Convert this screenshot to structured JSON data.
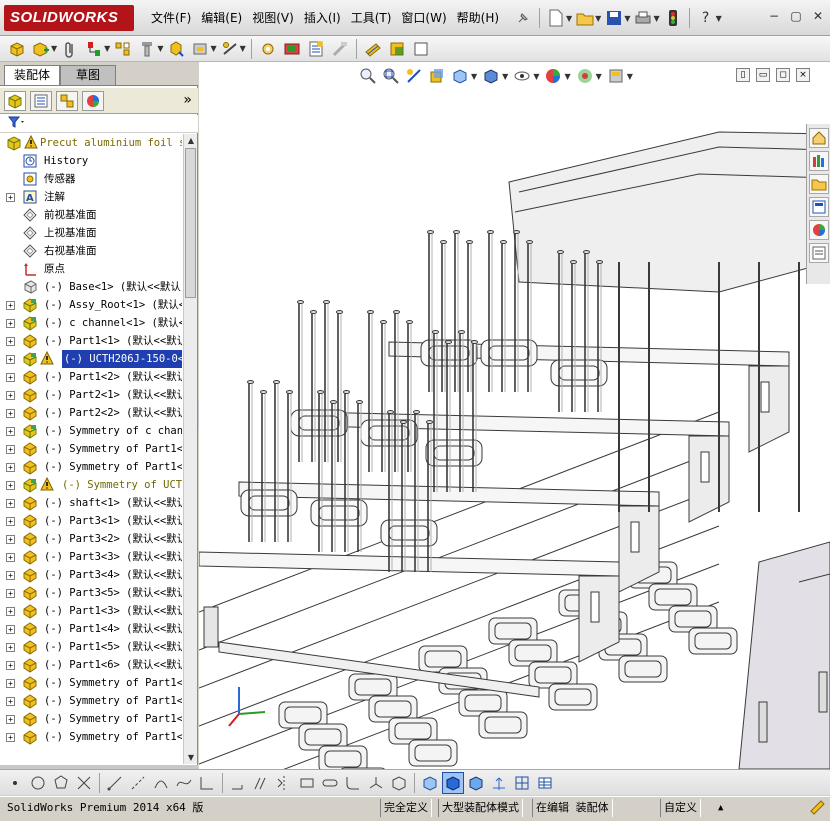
{
  "app": {
    "logo_text": "SOLIDWORKS"
  },
  "menu": [
    "文件(F)",
    "编辑(E)",
    "视图(V)",
    "插入(I)",
    "工具(T)",
    "窗口(W)",
    "帮助(H)"
  ],
  "title_tools": [
    "pin-icon",
    "new-document-icon",
    "open-folder-icon",
    "save-icon",
    "print-icon",
    "traffic-light-icon",
    "help-icon"
  ],
  "window_controls": {
    "minimize": "−",
    "restore": "▢",
    "close": "✕"
  },
  "command_toolbar": [
    "edit-component-icon",
    "insert-component-icon",
    "paperclip-icon",
    "mate-icon",
    "linear-pattern-icon",
    "smart-fasteners-icon",
    "move-component-icon",
    "show-hidden-icon",
    "assembly-features-icon",
    "reference-geometry-icon",
    "new-motion-study-icon",
    "bill-of-materials-icon",
    "exploded-view-icon",
    "explode-line-sketch-icon",
    "interference-detection-icon",
    "clearance-verification-icon",
    "hole-alignment-icon",
    "instant3d-icon"
  ],
  "left_tabs": {
    "assembly": "装配体",
    "sketch": "草图"
  },
  "feature_manager_tabs": [
    "feature-manager-icon",
    "property-manager-icon",
    "configuration-manager-icon",
    "display-manager-icon"
  ],
  "tree": {
    "root": "Precut aluminium foil se",
    "items": [
      {
        "label": "History",
        "icon": "history-icon",
        "expand": false,
        "kind": "folder"
      },
      {
        "label": "传感器",
        "icon": "sensor-icon",
        "expand": false,
        "kind": "folder"
      },
      {
        "label": "注解",
        "icon": "annotation-icon",
        "expand": true,
        "kind": "folder"
      },
      {
        "label": "前视基准面",
        "icon": "plane-icon",
        "expand": false,
        "kind": "plane"
      },
      {
        "label": "上视基准面",
        "icon": "plane-icon",
        "expand": false,
        "kind": "plane"
      },
      {
        "label": "右视基准面",
        "icon": "plane-icon",
        "expand": false,
        "kind": "plane"
      },
      {
        "label": "原点",
        "icon": "origin-icon",
        "expand": false,
        "kind": "origin"
      },
      {
        "label": "(-) Base<1> (默认<<默认",
        "icon": "part-icon",
        "expand": false,
        "kind": "part"
      },
      {
        "label": "(-) Assy_Root<1> (默认<",
        "icon": "subassembly-icon",
        "expand": true,
        "kind": "asm"
      },
      {
        "label": "(-) c channel<1> (默认<",
        "icon": "subassembly-icon",
        "expand": true,
        "kind": "asm"
      },
      {
        "label": "(-) Part1<1> (默认<<默认",
        "icon": "part-icon",
        "expand": true,
        "kind": "part"
      },
      {
        "label": "(-) UCTH206J-150-0<1",
        "icon": "subassembly-icon",
        "expand": true,
        "kind": "asm-warn-sel"
      },
      {
        "label": "(-) Part1<2> (默认<<默认",
        "icon": "part-icon",
        "expand": true,
        "kind": "part"
      },
      {
        "label": "(-) Part2<1> (默认<<默认",
        "icon": "part-icon",
        "expand": true,
        "kind": "part"
      },
      {
        "label": "(-) Part2<2> (默认<<默认",
        "icon": "part-icon",
        "expand": true,
        "kind": "part"
      },
      {
        "label": "(-) Symmetry of c chann",
        "icon": "subassembly-icon",
        "expand": true,
        "kind": "asm"
      },
      {
        "label": "(-) Symmetry of Part1<1",
        "icon": "part-icon",
        "expand": true,
        "kind": "part"
      },
      {
        "label": "(-) Symmetry of Part1<2",
        "icon": "part-icon",
        "expand": true,
        "kind": "part"
      },
      {
        "label": "(-) Symmetry of UCTH",
        "icon": "subassembly-icon",
        "expand": true,
        "kind": "asm-warn"
      },
      {
        "label": "(-) shaft<1> (默认<<默认",
        "icon": "part-icon",
        "expand": true,
        "kind": "part"
      },
      {
        "label": "(-) Part3<1> (默认<<默认",
        "icon": "part-icon",
        "expand": true,
        "kind": "part"
      },
      {
        "label": "(-) Part3<2> (默认<<默认",
        "icon": "part-icon",
        "expand": true,
        "kind": "part"
      },
      {
        "label": "(-) Part3<3> (默认<<默认",
        "icon": "part-icon",
        "expand": true,
        "kind": "part"
      },
      {
        "label": "(-) Part3<4> (默认<<默认",
        "icon": "part-icon",
        "expand": true,
        "kind": "part"
      },
      {
        "label": "(-) Part3<5> (默认<<默认",
        "icon": "part-icon",
        "expand": true,
        "kind": "part"
      },
      {
        "label": "(-) Part1<3> (默认<<默认",
        "icon": "part-icon",
        "expand": true,
        "kind": "part"
      },
      {
        "label": "(-) Part1<4> (默认<<默认",
        "icon": "part-icon",
        "expand": true,
        "kind": "part"
      },
      {
        "label": "(-) Part1<5> (默认<<默认",
        "icon": "part-icon",
        "expand": true,
        "kind": "part"
      },
      {
        "label": "(-) Part1<6> (默认<<默认",
        "icon": "part-icon",
        "expand": true,
        "kind": "part"
      },
      {
        "label": "(-) Symmetry of Part1<3",
        "icon": "part-icon",
        "expand": true,
        "kind": "part"
      },
      {
        "label": "(-) Symmetry of Part1<4",
        "icon": "part-icon",
        "expand": true,
        "kind": "part"
      },
      {
        "label": "(-) Symmetry of Part1<5",
        "icon": "part-icon",
        "expand": true,
        "kind": "part"
      },
      {
        "label": "(-) Symmetry of Part1<6",
        "icon": "part-icon",
        "expand": true,
        "kind": "part"
      }
    ]
  },
  "headsup_toolbar": [
    "zoom-to-fit-icon",
    "zoom-to-area-icon",
    "previous-view-icon",
    "section-view-icon",
    "view-orientation-icon",
    "display-style-icon",
    "hide-show-items-icon",
    "edit-appearance-icon",
    "apply-scene-icon",
    "view-settings-icon"
  ],
  "viewport_controls": [
    "split-horizontal-icon",
    "split-vertical-icon",
    "maximize-icon",
    "close-viewport-icon"
  ],
  "task_pane": [
    "solidworks-resources-icon",
    "design-library-icon",
    "file-explorer-icon",
    "view-palette-icon",
    "appearances-icon",
    "custom-properties-icon"
  ],
  "sketch_toolbar": [
    "point-icon",
    "circle-icon",
    "polygon-icon",
    "smart-dimension-icon",
    "line-icon",
    "centerline-icon",
    "arc-icon",
    "spline-icon",
    "trim-icon",
    "extend-icon",
    "offset-icon",
    "mirror-icon",
    "rectangle-icon",
    "slot-icon",
    "fillet-icon",
    "3d-sketch-icon",
    "box-icon",
    "cube-icon",
    "shaded-icon",
    "edges-icon",
    "axis-icon",
    "grid-icon",
    "table-icon"
  ],
  "status": {
    "product": "SolidWorks Premium 2014 x64 版",
    "definition": "完全定义",
    "mode": "大型装配体模式",
    "editing": "在编辑 装配体",
    "units": "自定义",
    "caret": "▲"
  },
  "colors": {
    "brand": "#b2141a",
    "selection": "#1f3fb0",
    "frame": "#d4d0c8"
  }
}
